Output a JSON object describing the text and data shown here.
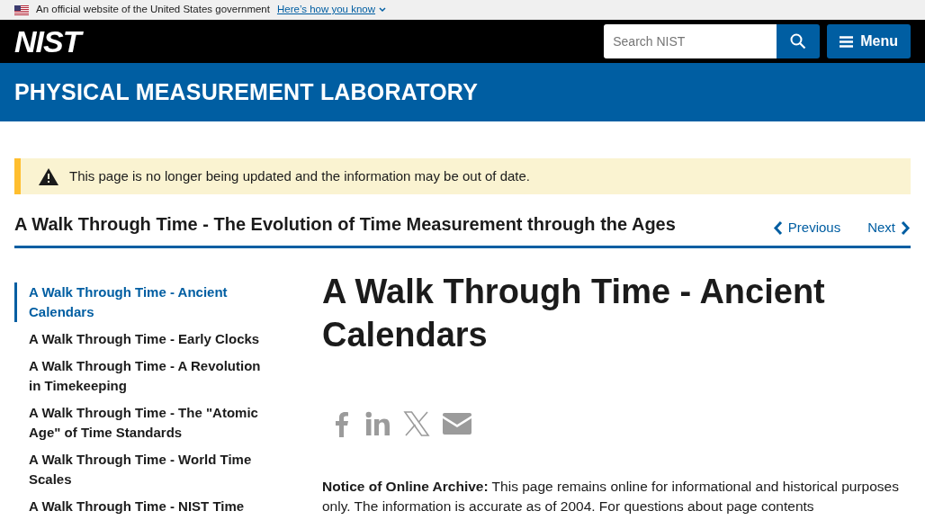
{
  "gov_banner": {
    "text": "An official website of the United States government",
    "link": "Here’s how you know"
  },
  "header": {
    "logo": "NIST",
    "search": {
      "placeholder": "Search NIST"
    },
    "menu_button": "Menu"
  },
  "lab_banner": {
    "title": "PHYSICAL MEASUREMENT LABORATORY"
  },
  "alert": {
    "text": "This page is no longer being updated and the information may be out of date."
  },
  "series": {
    "title": "A Walk Through Time - The Evolution of Time Measurement through the Ages",
    "previous": "Previous",
    "next": "Next"
  },
  "sidebar": {
    "items": [
      {
        "label": "A Walk Through Time - Ancient Calendars",
        "selected": true
      },
      {
        "label": "A Walk Through Time - Early Clocks",
        "selected": false
      },
      {
        "label": "A Walk Through Time - A Revolution in Timekeeping",
        "selected": false
      },
      {
        "label": "A Walk Through Time - The \"Atomic Age\" of Time Standards",
        "selected": false
      },
      {
        "label": "A Walk Through Time - World Time Scales",
        "selected": false
      },
      {
        "label": "A Walk Through Time - NIST Time",
        "selected": false
      }
    ]
  },
  "article": {
    "title": "A Walk Through Time - Ancient Calendars",
    "notice": "**Notice of Online Archive:** This page remains online for informational and historical purposes only. The information is accurate as of 2004. For questions about page contents"
  }
}
